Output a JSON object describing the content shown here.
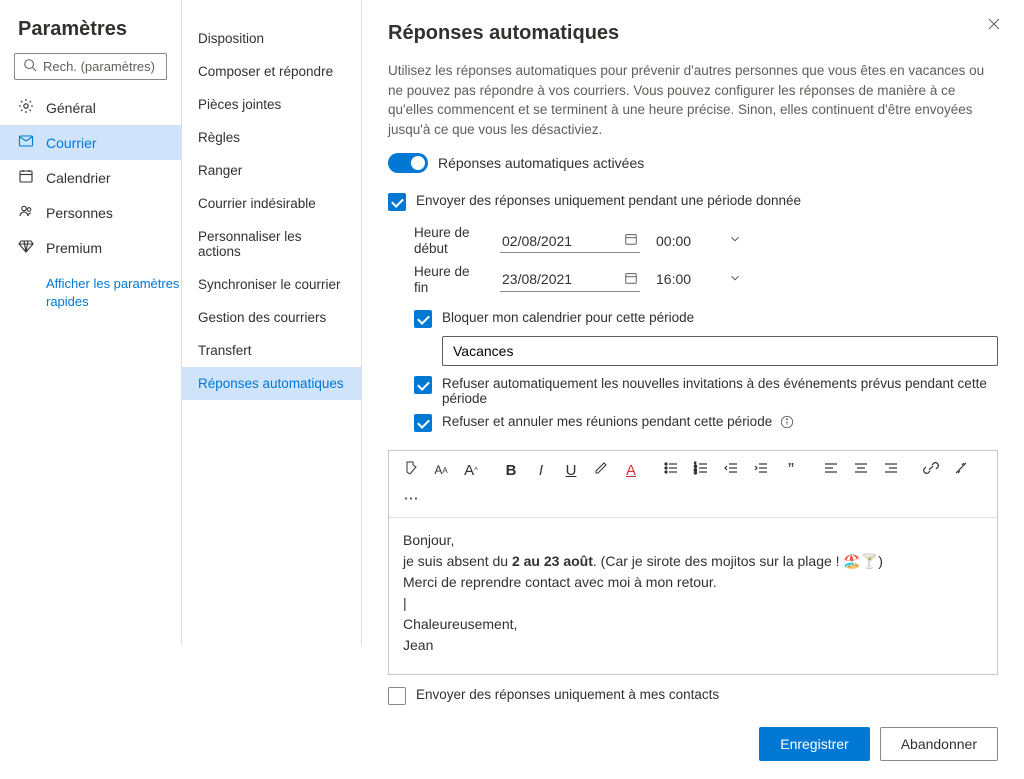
{
  "colors": {
    "accent": "#0078d4"
  },
  "left": {
    "title": "Paramètres",
    "search_placeholder": "Rech. (paramètres)",
    "items": [
      {
        "id": "general",
        "icon": "gear-icon",
        "label": "Général"
      },
      {
        "id": "mail",
        "icon": "mail-icon",
        "label": "Courrier",
        "active": true
      },
      {
        "id": "calendar",
        "icon": "calendar-icon",
        "label": "Calendrier"
      },
      {
        "id": "people",
        "icon": "people-icon",
        "label": "Personnes"
      },
      {
        "id": "premium",
        "icon": "diamond-icon",
        "label": "Premium"
      }
    ],
    "quick_link": "Afficher les paramètres rapides"
  },
  "mid": {
    "items": [
      "Disposition",
      "Composer et répondre",
      "Pièces jointes",
      "Règles",
      "Ranger",
      "Courrier indésirable",
      "Personnaliser les actions",
      "Synchroniser le courrier",
      "Gestion des courriers",
      "Transfert",
      "Réponses automatiques"
    ],
    "active_index": 10
  },
  "main": {
    "heading": "Réponses automatiques",
    "intro": "Utilisez les réponses automatiques pour prévenir d'autres personnes que vous êtes en vacances ou ne pouvez pas répondre à vos courriers. Vous pouvez configurer les réponses de manière à ce qu'elles commencent et se terminent à une heure précise. Sinon, elles continuent d'être envoyées jusqu'à ce que vous les désactiviez.",
    "toggle_label": "Réponses automatiques activées",
    "toggle_on": true,
    "period_check": {
      "label": "Envoyer des réponses uniquement pendant une période donnée",
      "checked": true
    },
    "start": {
      "label": "Heure de début",
      "date": "02/08/2021",
      "time": "00:00"
    },
    "end": {
      "label": "Heure de fin",
      "date": "23/08/2021",
      "time": "16:00"
    },
    "block_calendar": {
      "label": "Bloquer mon calendrier pour cette période",
      "checked": true,
      "value": "Vacances"
    },
    "decline_new": {
      "label": "Refuser automatiquement les nouvelles invitations à des événements prévus pendant cette période",
      "checked": true
    },
    "decline_cancel": {
      "label": "Refuser et annuler mes réunions pendant cette période",
      "checked": true
    },
    "message": {
      "line1": "Bonjour,",
      "line2_a": "je suis absent du ",
      "line2_b": "2 au 23 août",
      "line2_c": ". (Car je sirote des mojitos sur la plage ! 🏖️🍸)",
      "line3": "Merci de reprendre contact avec moi à mon retour.",
      "line5": "Chaleureusement,",
      "line6": "Jean"
    },
    "contacts_only": {
      "label": "Envoyer des réponses uniquement à mes contacts",
      "checked": false
    },
    "save": "Enregistrer",
    "discard": "Abandonner"
  }
}
